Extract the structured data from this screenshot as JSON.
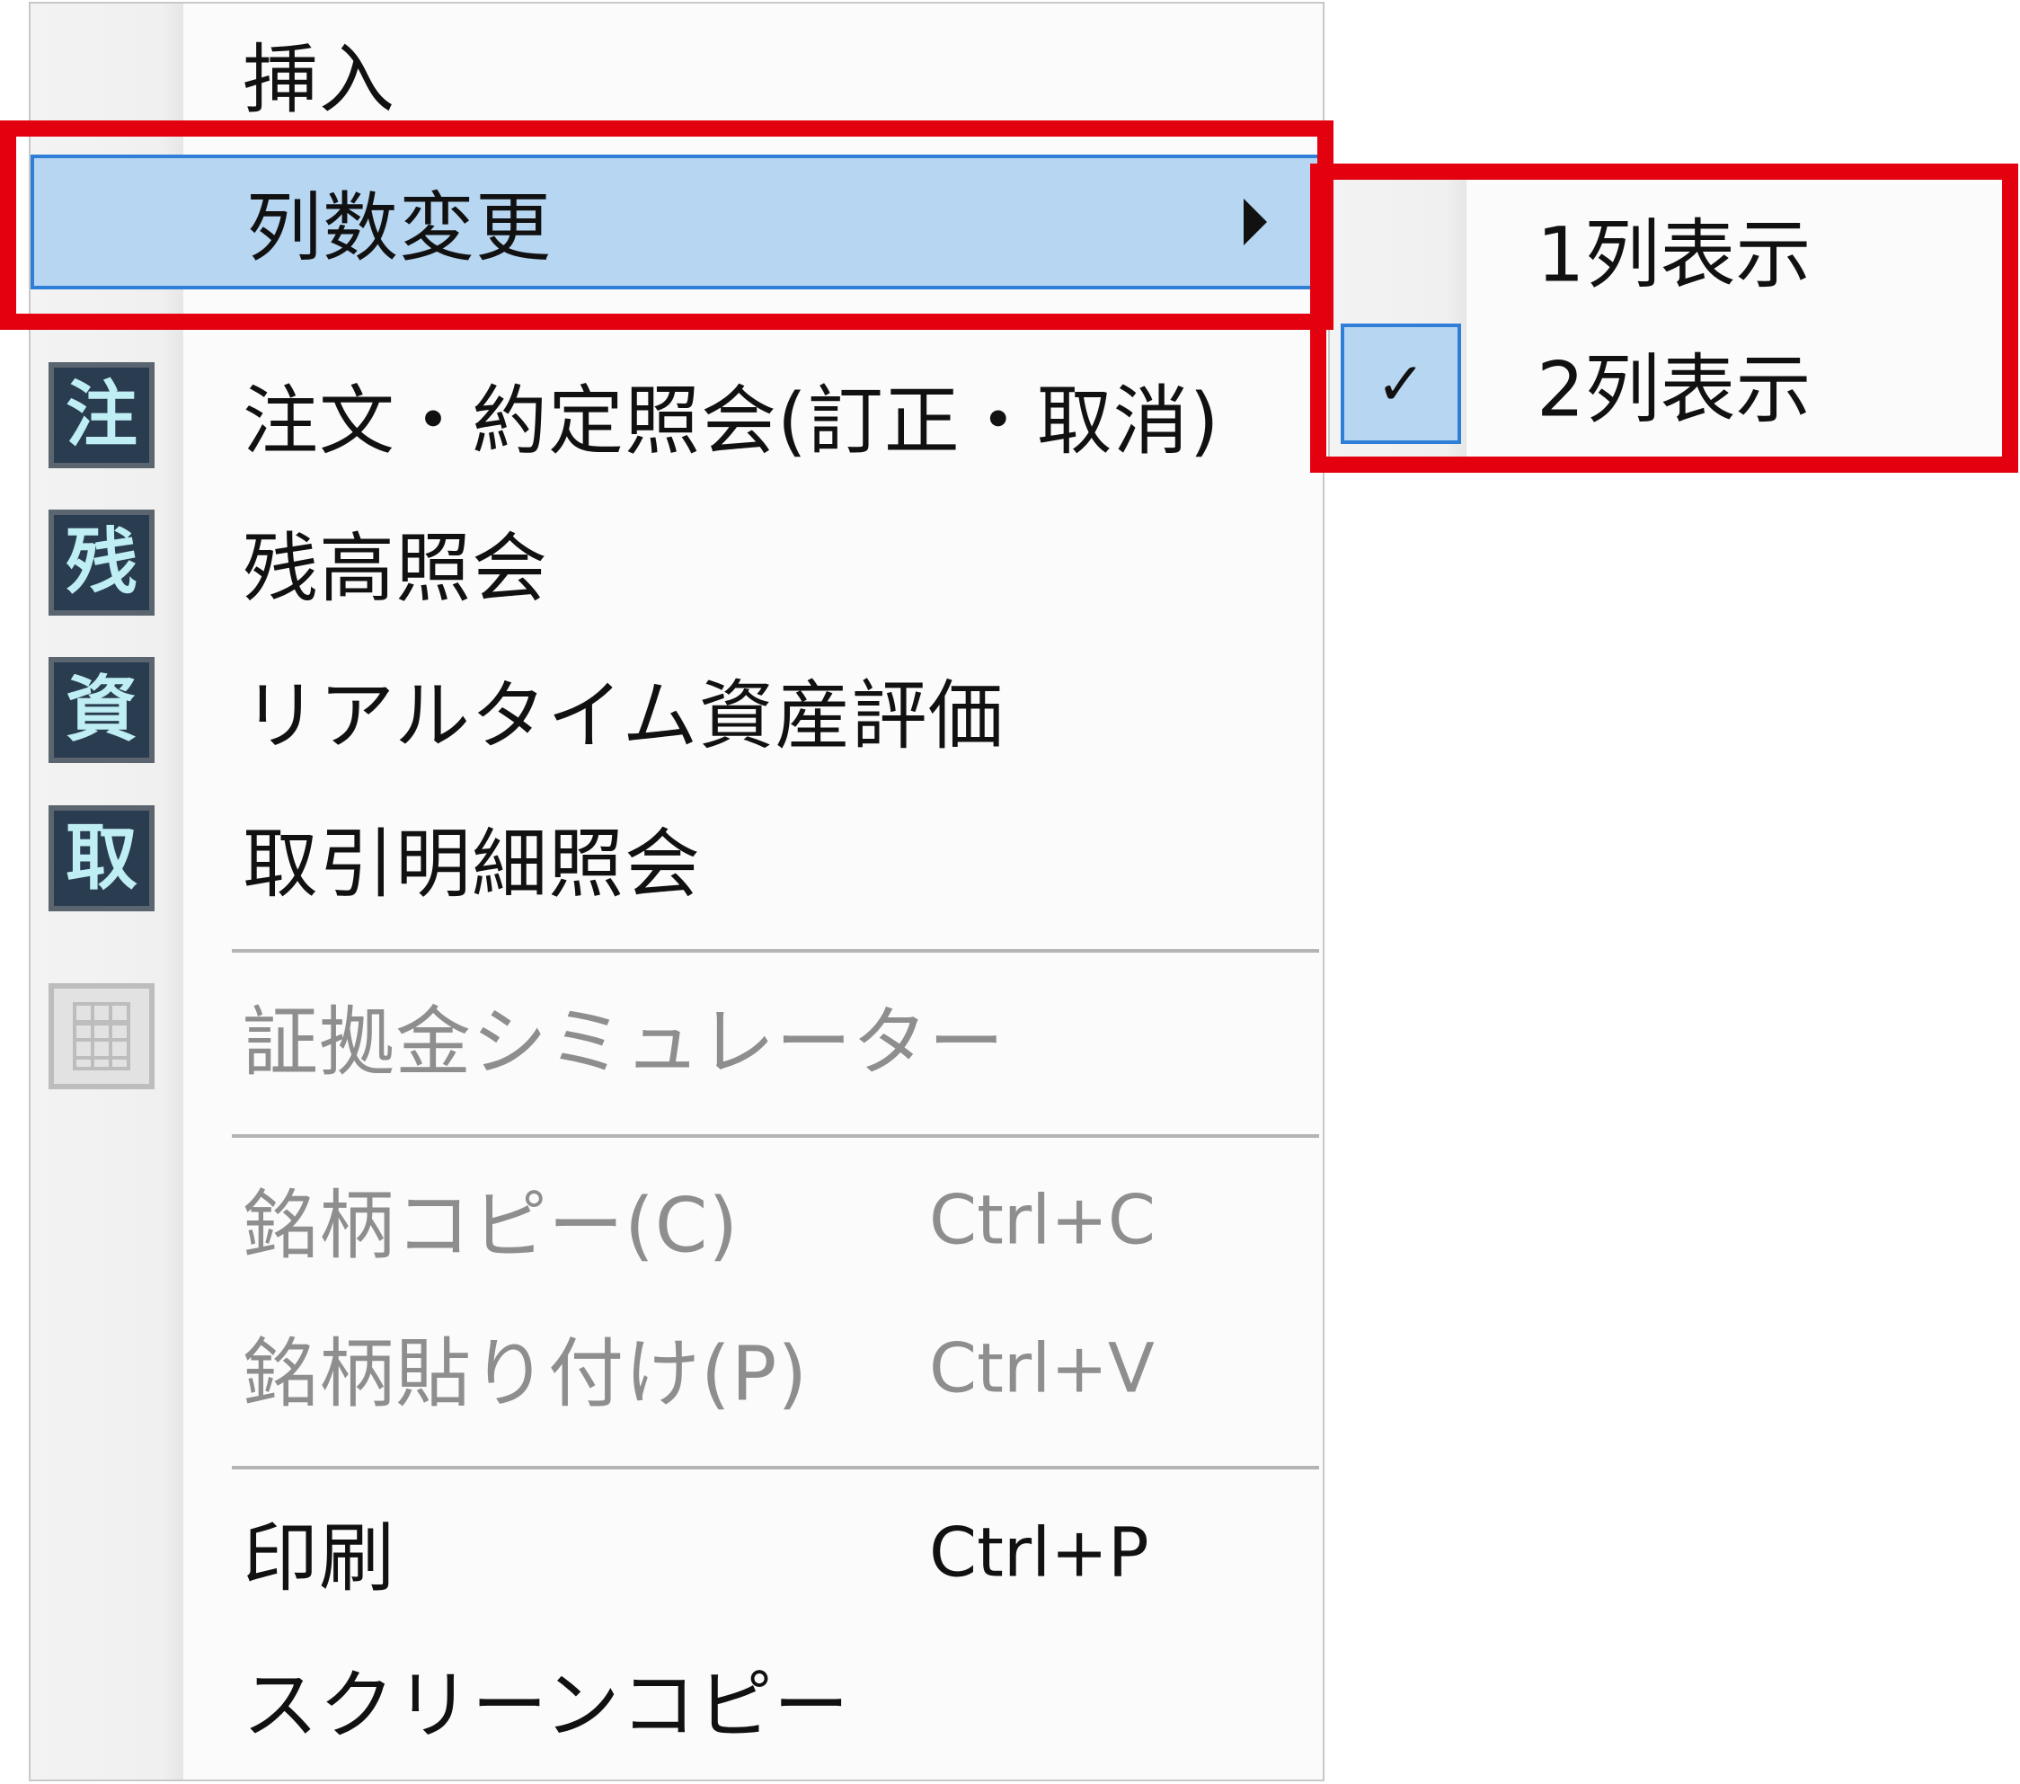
{
  "menu": {
    "items": [
      {
        "label": "挿入"
      },
      {
        "label": "列数変更"
      },
      {
        "label": "注文・約定照会(訂正・取消)",
        "icon_char": "注",
        "icon": "order-icon"
      },
      {
        "label": "残高照会",
        "icon_char": "残",
        "icon": "balance-icon"
      },
      {
        "label": "リアルタイム資産評価",
        "icon_char": "資",
        "icon": "asset-icon"
      },
      {
        "label": "取引明細照会",
        "icon_char": "取",
        "icon": "transaction-icon"
      },
      {
        "label": "証拠金シミュレーター",
        "icon": "calculator-icon"
      },
      {
        "label": "銘柄コピー(C)",
        "shortcut": "Ctrl+C"
      },
      {
        "label": "銘柄貼り付け(P)",
        "shortcut": "Ctrl+V"
      },
      {
        "label": "印刷",
        "shortcut": "Ctrl+P"
      },
      {
        "label": "スクリーンコピー"
      }
    ]
  },
  "submenu": {
    "items": [
      {
        "label": "1列表示",
        "checked": false
      },
      {
        "label": "2列表示",
        "checked": true,
        "check_glyph": "✓"
      }
    ]
  },
  "colors": {
    "highlight": "#b6d6f2",
    "highlight_border": "#2f7fd8",
    "annotation": "#e3000f",
    "disabled_text": "#8e8e8e"
  }
}
